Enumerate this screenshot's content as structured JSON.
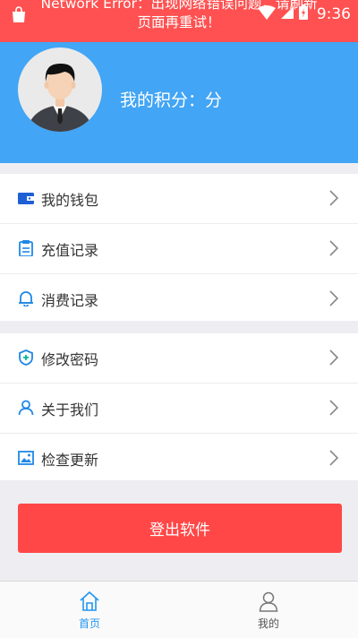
{
  "status_bar": {
    "error_text": "Network Error：出现网络错误问题，请刷新页面再重试！",
    "time": "9:36"
  },
  "profile": {
    "points_label": "我的积分：分"
  },
  "menu_group_1": [
    {
      "label": "我的钱包",
      "icon": "wallet-icon"
    },
    {
      "label": "充值记录",
      "icon": "clipboard-icon"
    },
    {
      "label": "消费记录",
      "icon": "bell-icon"
    }
  ],
  "menu_group_2": [
    {
      "label": "修改密码",
      "icon": "shield-plus-icon"
    },
    {
      "label": "关于我们",
      "icon": "person-icon"
    },
    {
      "label": "检查更新",
      "icon": "image-icon"
    }
  ],
  "logout_label": "登出软件",
  "tabs": [
    {
      "label": "首页",
      "icon": "home-icon",
      "active": true
    },
    {
      "label": "我的",
      "icon": "user-icon",
      "active": false
    }
  ],
  "colors": {
    "header": "#42a5f5",
    "status_bar": "#ff5151",
    "logout": "#ff4747",
    "tab_active": "#2196f3"
  }
}
